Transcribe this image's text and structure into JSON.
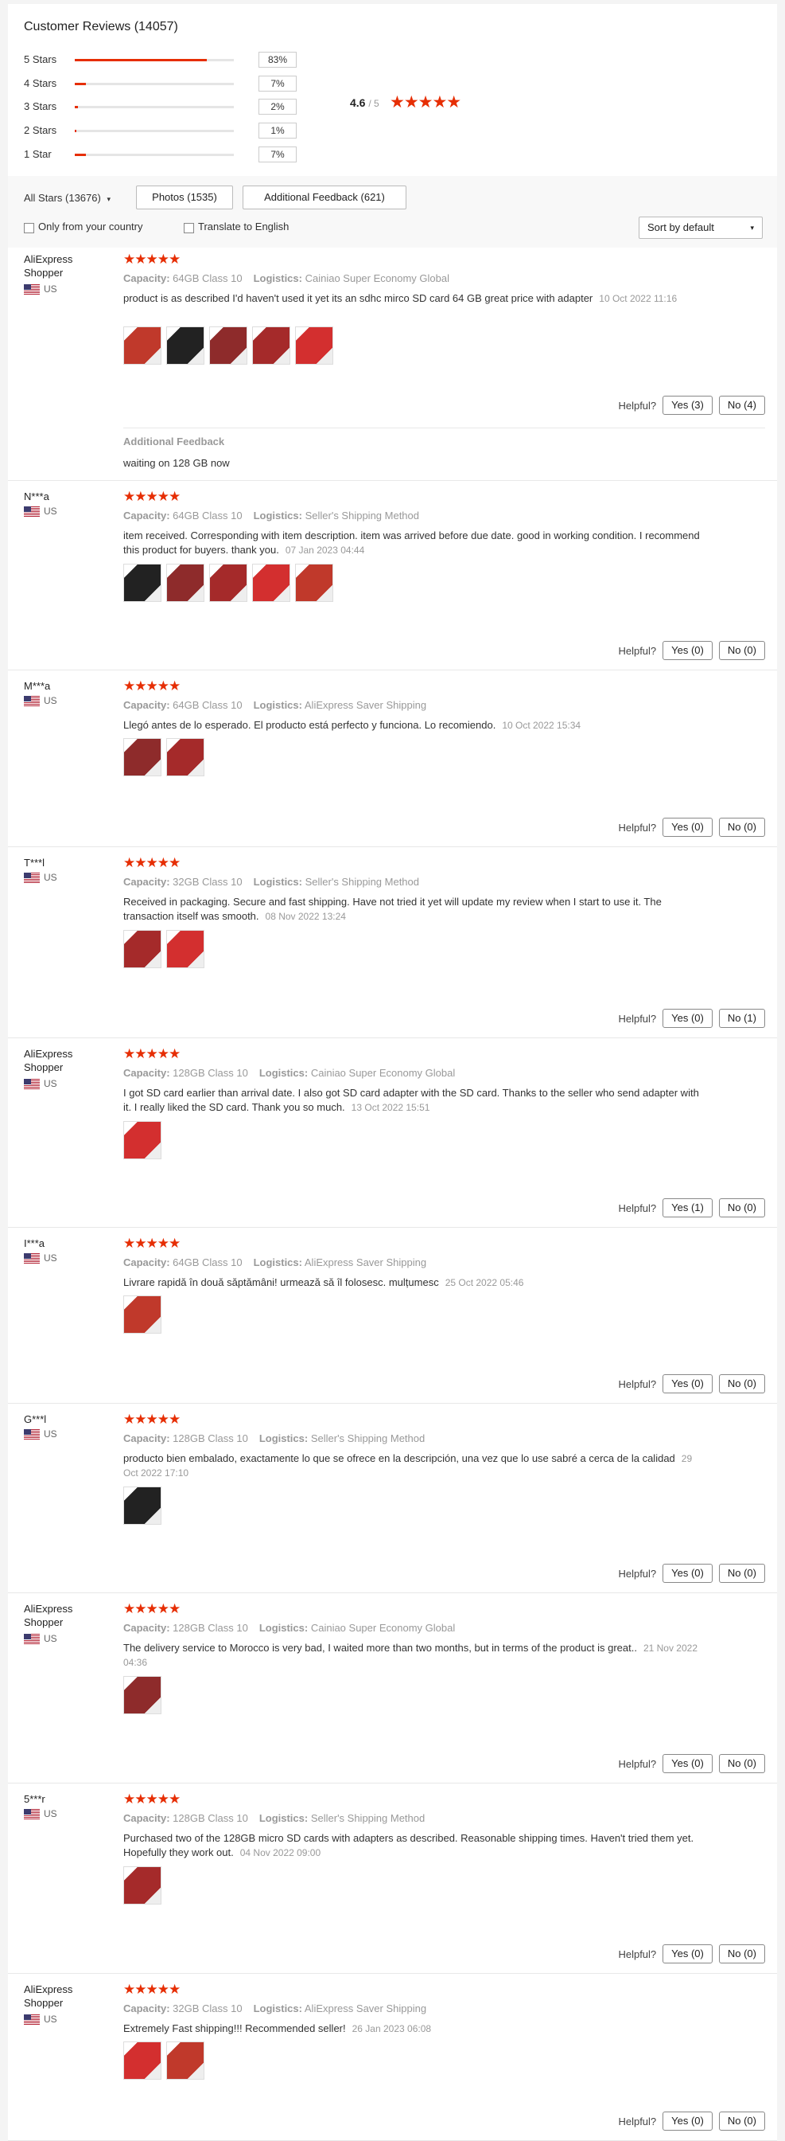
{
  "header": {
    "title": "Customer Reviews (14057)"
  },
  "breakdown": [
    {
      "label": "5 Stars",
      "pct": "83%",
      "value": 83
    },
    {
      "label": "4 Stars",
      "pct": "7%",
      "value": 7
    },
    {
      "label": "3 Stars",
      "pct": "2%",
      "value": 2
    },
    {
      "label": "2 Stars",
      "pct": "1%",
      "value": 1
    },
    {
      "label": "1 Star",
      "pct": "7%",
      "value": 7
    }
  ],
  "summary": {
    "avg": "4.6",
    "max": "/ 5",
    "stars": "★★★★★"
  },
  "filters": {
    "all_stars": "All Stars (13676)",
    "photos": "Photos (1535)",
    "additional": "Additional Feedback (621)",
    "only_country": "Only from your country",
    "translate": "Translate to English",
    "sort": "Sort by default"
  },
  "labels": {
    "helpful": "Helpful?",
    "capacity": "Capacity:",
    "logistics": "Logistics:",
    "additional_feedback": "Additional Feedback",
    "stars": "★★★★★"
  },
  "colors": {
    "accent": "#e62e04"
  },
  "reviews": [
    {
      "name": "AliExpress Shopper",
      "country": "US",
      "capacity": "64GB Class 10",
      "logistics": "Cainiao Super Economy Global",
      "text": "product is as described I'd haven't used it yet its an sdhc mirco SD card 64 GB great price with adapter",
      "date": "10 Oct 2022 11:16",
      "yes": "Yes (3)",
      "no": "No (4)",
      "feedback": "waiting on 128 GB now",
      "thumbs": 5
    },
    {
      "name": "N***a",
      "country": "US",
      "capacity": "64GB Class 10",
      "logistics": "Seller's Shipping Method",
      "text": "item received. Corresponding with item description. item was arrived before due date. good in working condition. I recommend this product for buyers. thank you.",
      "date": "07 Jan 2023 04:44",
      "yes": "Yes (0)",
      "no": "No (0)",
      "thumbs": 5
    },
    {
      "name": "M***a",
      "country": "US",
      "capacity": "64GB Class 10",
      "logistics": "AliExpress Saver Shipping",
      "text": "Llegó antes de lo esperado. El producto está perfecto y funciona. Lo recomiendo.",
      "date": "10 Oct 2022 15:34",
      "yes": "Yes (0)",
      "no": "No (0)",
      "thumbs": 2
    },
    {
      "name": "T***l",
      "country": "US",
      "capacity": "32GB Class 10",
      "logistics": "Seller's Shipping Method",
      "text": "Received in packaging. Secure and fast shipping. Have not tried it yet will update my review when I start to use it. The transaction itself was smooth.",
      "date": "08 Nov 2022 13:24",
      "yes": "Yes (0)",
      "no": "No (1)",
      "thumbs": 2
    },
    {
      "name": "AliExpress Shopper",
      "country": "US",
      "capacity": "128GB Class 10",
      "logistics": "Cainiao Super Economy Global",
      "text": "I got SD card earlier than arrival date. I also got SD card adapter with the SD card. Thanks to the seller who send adapter with it. I really liked the SD card. Thank you so much.",
      "date": "13 Oct 2022 15:51",
      "yes": "Yes (1)",
      "no": "No (0)",
      "thumbs": 1
    },
    {
      "name": "I***a",
      "country": "US",
      "capacity": "64GB Class 10",
      "logistics": "AliExpress Saver Shipping",
      "text": "Livrare rapidă în două săptămâni! urmează să îl folosesc. mulțumesc",
      "date": "25 Oct 2022 05:46",
      "yes": "Yes (0)",
      "no": "No (0)",
      "thumbs": 1
    },
    {
      "name": "G***l",
      "country": "US",
      "capacity": "128GB Class 10",
      "logistics": "Seller's Shipping Method",
      "text": "producto bien embalado, exactamente lo que se ofrece en la descripción, una vez que lo use sabré a cerca de la calidad",
      "date": "29 Oct 2022 17:10",
      "yes": "Yes (0)",
      "no": "No (0)",
      "thumbs": 1
    },
    {
      "name": "AliExpress Shopper",
      "country": "US",
      "capacity": "128GB Class 10",
      "logistics": "Cainiao Super Economy Global",
      "text": "The delivery service to Morocco is very bad, I waited more than two months, but in terms of the product is great..",
      "date": "21 Nov 2022 04:36",
      "yes": "Yes (0)",
      "no": "No (0)",
      "thumbs": 1
    },
    {
      "name": "5***r",
      "country": "US",
      "capacity": "128GB Class 10",
      "logistics": "Seller's Shipping Method",
      "text": "Purchased two of the 128GB micro SD cards with adapters as described. Reasonable shipping times. Haven't tried them yet. Hopefully they work out.",
      "date": "04 Nov 2022 09:00",
      "yes": "Yes (0)",
      "no": "No (0)",
      "thumbs": 1
    },
    {
      "name": "AliExpress Shopper",
      "country": "US",
      "capacity": "32GB Class 10",
      "logistics": "AliExpress Saver Shipping",
      "text": "Extremely Fast shipping!!! Recommended seller!",
      "date": "26 Jan 2023 06:08",
      "yes": "Yes (0)",
      "no": "No (0)",
      "thumbs": 2
    }
  ]
}
